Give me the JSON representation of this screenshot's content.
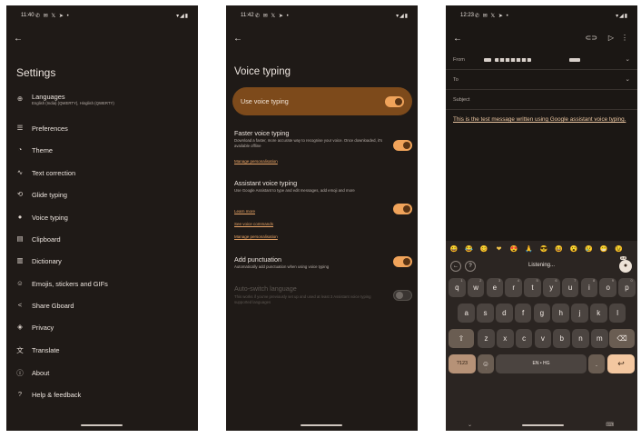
{
  "screens": {
    "settings": {
      "status": {
        "time": "11:40",
        "notifications": "✆ ✉ 𝕏 ➤ •",
        "system": "▾◢▮"
      },
      "title": "Settings",
      "items": [
        {
          "icon": "globe-icon",
          "glyph": "⊕",
          "label": "Languages",
          "sub": "English (India) (QWERTY), Hinglish (QWERTY)"
        },
        {
          "icon": "sliders-icon",
          "glyph": "☰",
          "label": "Preferences"
        },
        {
          "icon": "palette-icon",
          "glyph": "◔",
          "label": "Theme"
        },
        {
          "icon": "text-correction-icon",
          "glyph": "∿",
          "label": "Text correction"
        },
        {
          "icon": "glide-typing-icon",
          "glyph": "⟲",
          "label": "Glide typing"
        },
        {
          "icon": "mic-icon",
          "glyph": "●",
          "label": "Voice typing"
        },
        {
          "icon": "clipboard-icon",
          "glyph": "▤",
          "label": "Clipboard"
        },
        {
          "icon": "dictionary-icon",
          "glyph": "▥",
          "label": "Dictionary"
        },
        {
          "icon": "emoji-icon",
          "glyph": "☺",
          "label": "Emojis, stickers and GIFs"
        },
        {
          "icon": "share-icon",
          "glyph": "<",
          "label": "Share Gboard"
        },
        {
          "icon": "privacy-shield-icon",
          "glyph": "◈",
          "label": "Privacy"
        },
        {
          "icon": "translate-icon",
          "glyph": "文",
          "label": "Translate"
        },
        {
          "icon": "info-icon",
          "glyph": "ⓘ",
          "label": "About"
        },
        {
          "icon": "help-icon",
          "glyph": "?",
          "label": "Help & feedback"
        }
      ]
    },
    "voice": {
      "status": {
        "time": "11:42",
        "notifications": "✆ ✉ 𝕏 ➤ •",
        "system": "▾◢▮"
      },
      "title": "Voice typing",
      "use_voice_typing": "Use voice typing",
      "faster": {
        "heading": "Faster voice typing",
        "desc": "Download a faster, more accurate way to recognise your voice. Once downloaded, it's available offline",
        "link": "Manage personalisation"
      },
      "assistant": {
        "heading": "Assistant voice typing",
        "desc": "Use Google Assistant to type and edit messages, add emoji and more",
        "link1": "Learn more",
        "link2": "See voice commands",
        "link3": "Manage personalisation"
      },
      "punctuation": {
        "heading": "Add punctuation",
        "desc": "Automatically add punctuation when using voice typing"
      },
      "autoswitch": {
        "heading": "Auto-switch language",
        "desc": "This works if you've previously set up and used at least 3 Assistant voice typing supported languages"
      }
    },
    "email": {
      "status": {
        "time": "12:23",
        "notifications": "✆ ✉ 𝕏 ➤ •",
        "system": "▾◢▮"
      },
      "from_label": "From",
      "to_label": "To",
      "subject_placeholder": "Subject",
      "message": "This is the test message written using Google assistant voice typing.",
      "listening": "Listening...",
      "emojis": [
        "😀",
        "😂",
        "😊",
        "❤",
        "😍",
        "🙏",
        "😎",
        "😆",
        "😮",
        "😢",
        "😁",
        "😉"
      ],
      "rows": [
        [
          [
            "q",
            "1"
          ],
          [
            "w",
            "2"
          ],
          [
            "e",
            "3"
          ],
          [
            "r",
            "4"
          ],
          [
            "t",
            "5"
          ],
          [
            "y",
            "6"
          ],
          [
            "u",
            "7"
          ],
          [
            "i",
            "8"
          ],
          [
            "o",
            "9"
          ],
          [
            "p",
            "0"
          ]
        ],
        [
          [
            "a",
            ""
          ],
          [
            "s",
            ""
          ],
          [
            "d",
            ""
          ],
          [
            "f",
            ""
          ],
          [
            "g",
            ""
          ],
          [
            "h",
            ""
          ],
          [
            "j",
            ""
          ],
          [
            "k",
            ""
          ],
          [
            "l",
            ""
          ]
        ],
        [
          [
            "z",
            ""
          ],
          [
            "x",
            ""
          ],
          [
            "c",
            ""
          ],
          [
            "v",
            ""
          ],
          [
            "b",
            ""
          ],
          [
            "n",
            ""
          ],
          [
            "m",
            ""
          ]
        ]
      ],
      "sym_key": "?123",
      "comma_key": ",",
      "emoji_key": "☺",
      "space_key": "EN • HG",
      "period_key": ".",
      "enter_key": "↩",
      "shift_key": "⇧",
      "backspace_key": "⌫",
      "badge": "3.8"
    }
  }
}
